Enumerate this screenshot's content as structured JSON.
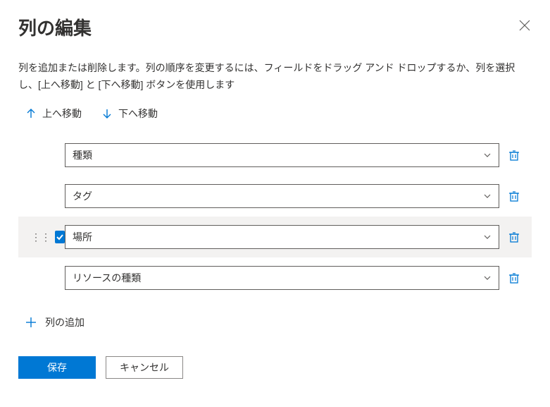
{
  "header": {
    "title": "列の編集"
  },
  "description": "列を追加または削除します。列の順序を変更するには、フィールドをドラッグ アンド ドロップするか、列を選択し、[上へ移動] と [下へ移動] ボタンを使用します",
  "move": {
    "up_label": "上へ移動",
    "down_label": "下へ移動"
  },
  "columns": [
    {
      "label": "種類",
      "selected": false
    },
    {
      "label": "タグ",
      "selected": false
    },
    {
      "label": "場所",
      "selected": true
    },
    {
      "label": "リソースの種類",
      "selected": false
    }
  ],
  "add_column_label": "列の追加",
  "footer": {
    "save_label": "保存",
    "cancel_label": "キャンセル"
  }
}
